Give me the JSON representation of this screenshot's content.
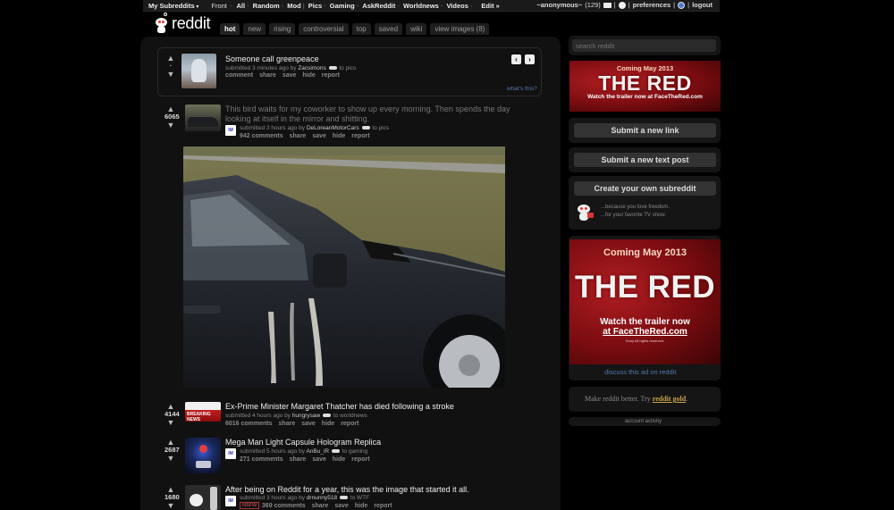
{
  "topbar": {
    "my_subreddits": "My Subreddits",
    "links": [
      "Front",
      "All",
      "Random",
      "Mod",
      "Pics",
      "Gaming",
      "AskReddit",
      "Worldnews",
      "Videos"
    ],
    "separator": "-",
    "edit": "Edit »",
    "username": "~anonymous~",
    "karma": "(129)",
    "preferences": "preferences",
    "logout": "logout",
    "divider": "|"
  },
  "header": {
    "logo": "reddit",
    "tabs": [
      "hot",
      "new",
      "rising",
      "controversial",
      "top",
      "saved",
      "wiki",
      "view images (8)"
    ]
  },
  "spotlight": {
    "title": "Someone call greenpeace",
    "tagline_pre": "submitted 3 minutes ago by",
    "author": "Zacsimons",
    "tagline_post": "to pics",
    "actions": [
      "comment",
      "share",
      "save",
      "hide",
      "report"
    ],
    "prev": "‹",
    "next": "›",
    "whats_this": "what's this?"
  },
  "posts": [
    {
      "score": "6065",
      "title_line1": "This bird waits for my coworker to show up every morning. Then spends the day",
      "title_line2": "looking at itself in the mirror and shitting.",
      "tagline_pre": "submitted 3 hours ago by",
      "author": "DeLoreanMotorCars",
      "tagline_post": "to pics",
      "comments": "942 comments",
      "actions": [
        "share",
        "save",
        "hide",
        "report"
      ]
    },
    {
      "score": "4144",
      "title": "Ex-Prime Minister Margaret Thatcher has died following a stroke",
      "tagline_pre": "submitted 4 hours ago by",
      "author": "hungrysaw",
      "tagline_post": "to worldnews",
      "comments": "6016 comments",
      "actions": [
        "share",
        "save",
        "hide",
        "report"
      ],
      "thumb_text": "BREAKING NEWS"
    },
    {
      "score": "2687",
      "title": "Mega Man Light Capsule Hologram Replica",
      "tagline_pre": "submitted 5 hours ago by",
      "author": "AnBu_iR",
      "tagline_post": "to gaming",
      "comments": "271 comments",
      "actions": [
        "share",
        "save",
        "hide",
        "report"
      ]
    },
    {
      "score": "1680",
      "title": "After being on Reddit for a year, this was the image that started it all.",
      "tagline_pre": "submitted 3 hours ago by",
      "author": "drnunny518",
      "tagline_post": "to WTF",
      "nsfw": "NSFW",
      "comments": "369 comments",
      "actions": [
        "share",
        "save",
        "hide",
        "report"
      ]
    }
  ],
  "sidebar": {
    "search_placeholder": "search reddit",
    "ad_small": {
      "coming": "Coming May 2013",
      "title": "THE RED",
      "trailer": "Watch the trailer now at FaceTheRed.com"
    },
    "submit_link": "Submit a new link",
    "submit_text": "Submit a new text post",
    "create_subreddit": "Create your own subreddit",
    "create_line1": "...because you love freedom.",
    "create_line2": "...for your favorite TV show.",
    "ad_big": {
      "coming": "Coming May 2013",
      "title": "THE RED",
      "trailer1": "Watch the trailer now",
      "trailer2": "at FaceTheRed.com",
      "fine": "Sony All rights reserved."
    },
    "discuss_ad": "discuss this ad on reddit",
    "gold_pre": "Make reddit better. Try",
    "gold_link": "reddit gold",
    "gold_post": ".",
    "account_activity": "account activity"
  },
  "colors": {
    "background": "#000000",
    "panel": "#111111",
    "ad_red": "#b01e22",
    "gold": "#c8a24a",
    "link_blue": "#5577aa"
  }
}
